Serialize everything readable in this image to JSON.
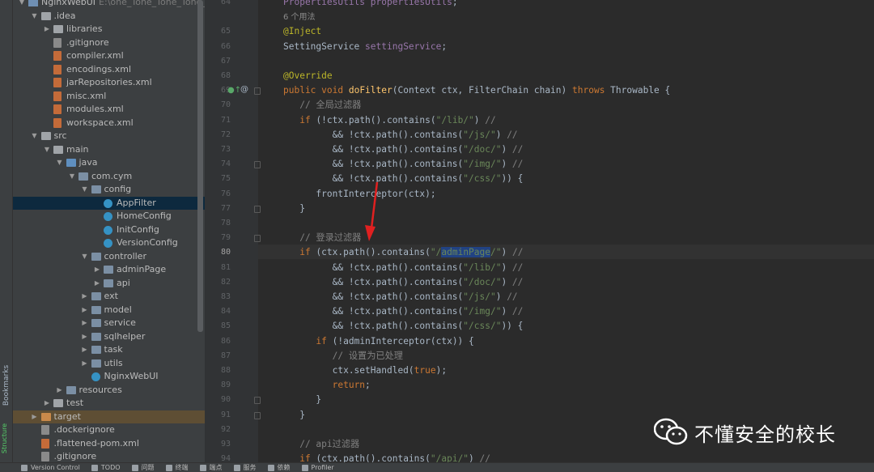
{
  "project_tree": [
    {
      "label": "NginxWebUI",
      "path": "E:\\one_Tone_Tone_Tone_Tone",
      "depth": 0,
      "expanded": true,
      "icon": "module-folder"
    },
    {
      "label": ".idea",
      "depth": 1,
      "expanded": true,
      "icon": "folder"
    },
    {
      "label": "libraries",
      "depth": 2,
      "expanded": false,
      "icon": "folder"
    },
    {
      "label": ".gitignore",
      "depth": 2,
      "icon": "gitignore-file"
    },
    {
      "label": "compiler.xml",
      "depth": 2,
      "icon": "xml-file"
    },
    {
      "label": "encodings.xml",
      "depth": 2,
      "icon": "xml-file"
    },
    {
      "label": "jarRepositories.xml",
      "depth": 2,
      "icon": "xml-file"
    },
    {
      "label": "misc.xml",
      "depth": 2,
      "icon": "xml-file"
    },
    {
      "label": "modules.xml",
      "depth": 2,
      "icon": "xml-file"
    },
    {
      "label": "workspace.xml",
      "depth": 2,
      "icon": "xml-file"
    },
    {
      "label": "src",
      "depth": 1,
      "expanded": true,
      "icon": "folder"
    },
    {
      "label": "main",
      "depth": 2,
      "expanded": true,
      "icon": "folder"
    },
    {
      "label": "java",
      "depth": 3,
      "expanded": true,
      "icon": "source-folder"
    },
    {
      "label": "com.cym",
      "depth": 4,
      "expanded": true,
      "icon": "package"
    },
    {
      "label": "config",
      "depth": 5,
      "expanded": true,
      "icon": "package"
    },
    {
      "label": "AppFilter",
      "depth": 6,
      "icon": "class",
      "selected": true
    },
    {
      "label": "HomeConfig",
      "depth": 6,
      "icon": "class"
    },
    {
      "label": "InitConfig",
      "depth": 6,
      "icon": "class"
    },
    {
      "label": "VersionConfig",
      "depth": 6,
      "icon": "class"
    },
    {
      "label": "controller",
      "depth": 5,
      "expanded": true,
      "icon": "package"
    },
    {
      "label": "adminPage",
      "depth": 6,
      "expanded": false,
      "icon": "package"
    },
    {
      "label": "api",
      "depth": 6,
      "expanded": false,
      "icon": "package"
    },
    {
      "label": "ext",
      "depth": 5,
      "expanded": false,
      "icon": "package"
    },
    {
      "label": "model",
      "depth": 5,
      "expanded": false,
      "icon": "package"
    },
    {
      "label": "service",
      "depth": 5,
      "expanded": false,
      "icon": "package"
    },
    {
      "label": "sqlhelper",
      "depth": 5,
      "expanded": false,
      "icon": "package"
    },
    {
      "label": "task",
      "depth": 5,
      "expanded": false,
      "icon": "package"
    },
    {
      "label": "utils",
      "depth": 5,
      "expanded": false,
      "icon": "package"
    },
    {
      "label": "NginxWebUI",
      "depth": 5,
      "icon": "class"
    },
    {
      "label": "resources",
      "depth": 3,
      "expanded": false,
      "icon": "resources-folder"
    },
    {
      "label": "test",
      "depth": 2,
      "expanded": false,
      "icon": "folder"
    },
    {
      "label": "target",
      "depth": 1,
      "expanded": false,
      "icon": "excluded-folder",
      "excluded": true
    },
    {
      "label": ".dockerignore",
      "depth": 1,
      "icon": "text-file"
    },
    {
      "label": ".flattened-pom.xml",
      "depth": 1,
      "icon": "xml-file"
    },
    {
      "label": ".gitignore",
      "depth": 1,
      "icon": "gitignore-file"
    }
  ],
  "side_tabs": {
    "bookmarks": "Bookmarks",
    "structure": "Structure"
  },
  "code_lines": [
    {
      "no": "64",
      "html": "<span class=\"field\">PropertiesUtils</span> <span class=\"field\">propertiesUtils</span>;"
    },
    {
      "no": "",
      "html": "<span class=\"hint\">6 个用法</span>"
    },
    {
      "no": "65",
      "html": "<span class=\"ann\">@Inject</span>"
    },
    {
      "no": "66",
      "html": "SettingService <span class=\"field\">settingService</span>;"
    },
    {
      "no": "67",
      "html": ""
    },
    {
      "no": "68",
      "html": "<span class=\"ann\">@Override</span>"
    },
    {
      "no": "69",
      "html": "<span class=\"kw\">public void</span> <span class=\"fn\">doFilter</span>(Context ctx, FilterChain chain) <span class=\"kw\">throws</span> Throwable {"
    },
    {
      "no": "70",
      "html": "   <span class=\"cmt\">// 全局过滤器</span>"
    },
    {
      "no": "71",
      "html": "   <span class=\"kw\">if</span> (!ctx.path().contains(<span class=\"str\">\"/lib/\"</span>) <span class=\"cmt\">//</span>"
    },
    {
      "no": "72",
      "html": "         &amp;&amp; !ctx.path().contains(<span class=\"str\">\"/js/\"</span>) <span class=\"cmt\">//</span>"
    },
    {
      "no": "73",
      "html": "         &amp;&amp; !ctx.path().contains(<span class=\"str\">\"/doc/\"</span>) <span class=\"cmt\">//</span>"
    },
    {
      "no": "74",
      "html": "         &amp;&amp; !ctx.path().contains(<span class=\"str\">\"/img/\"</span>) <span class=\"cmt\">//</span>"
    },
    {
      "no": "75",
      "html": "         &amp;&amp; !ctx.path().contains(<span class=\"str\">\"/css/\"</span>)) {"
    },
    {
      "no": "76",
      "html": "      frontInterceptor(ctx);"
    },
    {
      "no": "77",
      "html": "   }"
    },
    {
      "no": "78",
      "html": ""
    },
    {
      "no": "79",
      "html": "   <span class=\"cmt\">// 登录过滤器</span>"
    },
    {
      "no": "80",
      "html": "   <span class=\"kw\">if</span> (ctx.path().contains(<span class=\"str\">\"/<span class=\"sel\">adminPage</span>/\"</span>) <span class=\"cmt\">//</span>",
      "current": true
    },
    {
      "no": "81",
      "html": "         &amp;&amp; !ctx.path().contains(<span class=\"str\">\"/lib/\"</span>) <span class=\"cmt\">//</span>"
    },
    {
      "no": "82",
      "html": "         &amp;&amp; !ctx.path().contains(<span class=\"str\">\"/doc/\"</span>) <span class=\"cmt\">//</span>"
    },
    {
      "no": "83",
      "html": "         &amp;&amp; !ctx.path().contains(<span class=\"str\">\"/js/\"</span>) <span class=\"cmt\">//</span>"
    },
    {
      "no": "84",
      "html": "         &amp;&amp; !ctx.path().contains(<span class=\"str\">\"/img/\"</span>) <span class=\"cmt\">//</span>"
    },
    {
      "no": "85",
      "html": "         &amp;&amp; !ctx.path().contains(<span class=\"str\">\"/css/\"</span>)) {"
    },
    {
      "no": "86",
      "html": "      <span class=\"kw\">if</span> (!adminInterceptor(ctx)) {"
    },
    {
      "no": "87",
      "html": "         <span class=\"cmt\">// 设置为已处理</span>"
    },
    {
      "no": "88",
      "html": "         ctx.setHandled(<span class=\"kw\">true</span>);"
    },
    {
      "no": "89",
      "html": "         <span class=\"kw\">return</span>;"
    },
    {
      "no": "90",
      "html": "      }"
    },
    {
      "no": "91",
      "html": "   }"
    },
    {
      "no": "92",
      "html": ""
    },
    {
      "no": "93",
      "html": "   <span class=\"cmt\">// api过滤器</span>"
    },
    {
      "no": "94",
      "html": "   <span class=\"kw\">if</span> (ctx.path().contains(<span class=\"str\">\"/api/\"</span>) <span class=\"cmt\">//</span>"
    }
  ],
  "watermark": {
    "text": "不懂安全的校长"
  },
  "bottom_tools": [
    {
      "label": "Version Control",
      "icon": "branch-icon"
    },
    {
      "label": "TODO",
      "icon": "list-icon"
    },
    {
      "label": "问题",
      "icon": "problems-icon"
    },
    {
      "label": "终端",
      "icon": "terminal-icon"
    },
    {
      "label": "端点",
      "icon": "endpoints-icon"
    },
    {
      "label": "服务",
      "icon": "services-icon"
    },
    {
      "label": "依赖",
      "icon": "dependencies-icon"
    },
    {
      "label": "Profiler",
      "icon": "profiler-icon"
    }
  ],
  "colors": {
    "panel_bg": "#3c3f41",
    "editor_bg": "#2b2b2b",
    "selection": "#0d293e",
    "arrow": "#e02020"
  }
}
